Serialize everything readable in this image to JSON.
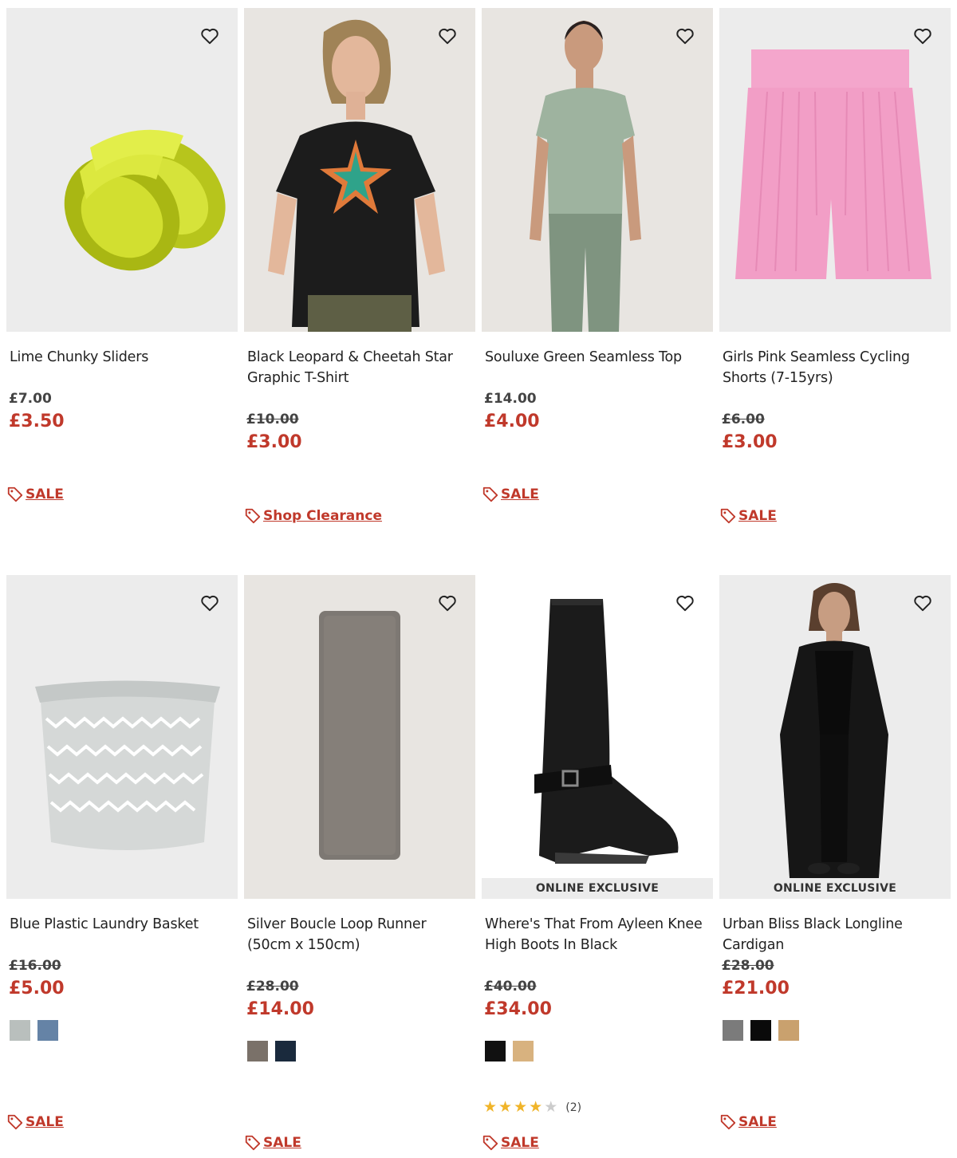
{
  "products": [
    {
      "title": "Lime Chunky Sliders",
      "was": "£7.00",
      "now": "£3.50",
      "tag": "SALE",
      "icon": "heart-icon"
    },
    {
      "title": "Black Leopard & Cheetah Star Graphic T-Shirt",
      "was": "£10.00",
      "now": "£3.00",
      "tag": "Shop Clearance"
    },
    {
      "title": "Souluxe Green Seamless Top",
      "was": "£14.00",
      "now": "£4.00",
      "tag": "SALE"
    },
    {
      "title": "Girls Pink Seamless Cycling Shorts (7-15yrs)",
      "was": "£6.00",
      "now": "£3.00",
      "tag": "SALE"
    },
    {
      "title": "Blue Plastic Laundry Basket",
      "was": "£16.00",
      "now": "£5.00",
      "tag": "SALE",
      "swatches": [
        "#b9bfbd",
        "#6583a6"
      ]
    },
    {
      "title": "Silver Boucle Loop Runner (50cm x 150cm)",
      "was": "£28.00",
      "now": "£14.00",
      "tag": "SALE",
      "swatches": [
        "#7a7169",
        "#1a2a3d"
      ]
    },
    {
      "title": "Where's That From Ayleen Knee High Boots In Black",
      "was": "£40.00",
      "now": "£34.00",
      "tag": "SALE",
      "badge": "ONLINE EXCLUSIVE",
      "swatches": [
        "#111111",
        "#d8b27f"
      ],
      "rating": 4,
      "reviews": "(2)"
    },
    {
      "title": "Urban Bliss Black Longline Cardigan",
      "was": "£28.00",
      "now": "£21.00",
      "tag": "SALE",
      "badge": "ONLINE EXCLUSIVE",
      "swatches": [
        "#7b7b7b",
        "#0a0a0a",
        "#c9a16e"
      ]
    }
  ],
  "colors": {
    "accent": "#c0392b",
    "star": "#f0b429",
    "star_empty": "#cccccc"
  }
}
